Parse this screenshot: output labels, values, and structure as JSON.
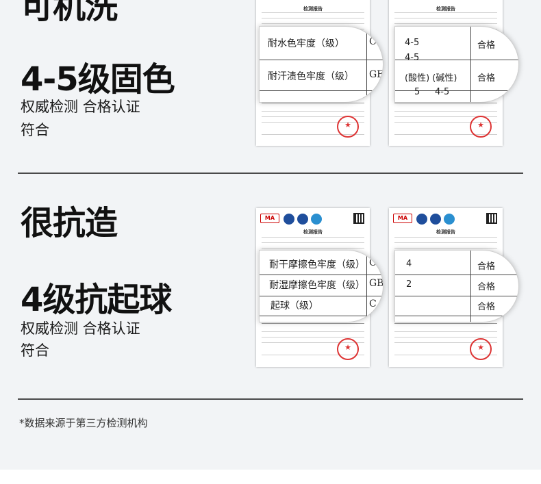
{
  "sec1": {
    "headline_partial": "可机洗",
    "headline": "4-5级固色",
    "sub1": "权威检测 合格认证",
    "sub2": "符合",
    "doc": {
      "title": "检测报告"
    },
    "zoomA": {
      "row1": "耐水色牢度（级）",
      "row2": "耐汗渍色牢度（级）",
      "c1": "C",
      "c2": "GE"
    },
    "zoomB": {
      "r1a": "4-5",
      "r1b": "4-5",
      "r1status": "合格",
      "r2a": "(酸性) (碱性)",
      "r2status": "合格",
      "r3a": "5",
      "r3b": "4-5"
    }
  },
  "sec2": {
    "headline": "很抗造",
    "headline2": "4级抗起球",
    "sub1": "权威检测 合格认证",
    "sub2": "符合",
    "doc": {
      "title": "检测报告",
      "ma": "MA"
    },
    "zoomA": {
      "row1": "耐干摩擦色牢度（级）",
      "row2": "耐湿摩擦色牢度（级）",
      "row3": "起球（级）",
      "c1": "C",
      "c2": "GB",
      "c3": "C"
    },
    "zoomB": {
      "r1": "4",
      "r1status": "合格",
      "r2": "2",
      "r2status": "合格",
      "r3status": "合格"
    }
  },
  "footnote": "*数据来源于第三方检测机构"
}
